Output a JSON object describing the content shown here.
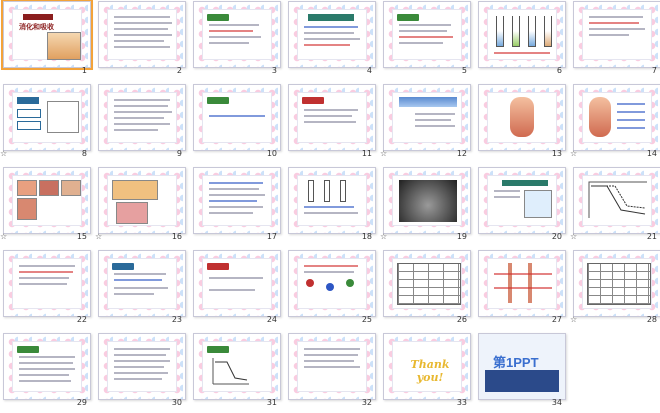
{
  "slides": [
    {
      "number": "1",
      "starred": false
    },
    {
      "number": "2",
      "starred": false
    },
    {
      "number": "3",
      "starred": false
    },
    {
      "number": "4",
      "starred": false
    },
    {
      "number": "5",
      "starred": false
    },
    {
      "number": "6",
      "starred": false
    },
    {
      "number": "7",
      "starred": false
    },
    {
      "number": "8",
      "starred": true
    },
    {
      "number": "9",
      "starred": false
    },
    {
      "number": "10",
      "starred": false
    },
    {
      "number": "11",
      "starred": false
    },
    {
      "number": "12",
      "starred": true
    },
    {
      "number": "13",
      "starred": false
    },
    {
      "number": "14",
      "starred": true
    },
    {
      "number": "15",
      "starred": true
    },
    {
      "number": "16",
      "starred": true
    },
    {
      "number": "17",
      "starred": false
    },
    {
      "number": "18",
      "starred": false
    },
    {
      "number": "19",
      "starred": true
    },
    {
      "number": "20",
      "starred": false
    },
    {
      "number": "21",
      "starred": true
    },
    {
      "number": "22",
      "starred": false
    },
    {
      "number": "23",
      "starred": false
    },
    {
      "number": "24",
      "starred": false
    },
    {
      "number": "25",
      "starred": false
    },
    {
      "number": "26",
      "starred": false
    },
    {
      "number": "27",
      "starred": false
    },
    {
      "number": "28",
      "starred": true
    },
    {
      "number": "29",
      "starred": false
    },
    {
      "number": "30",
      "starred": false
    },
    {
      "number": "31",
      "starred": false
    },
    {
      "number": "32",
      "starred": false
    },
    {
      "number": "33",
      "starred": false
    },
    {
      "number": "34",
      "starred": false
    }
  ],
  "star_glyph": "☆",
  "slide1_title": "消化和吸收",
  "slide33_text": "Thank you!",
  "slide34_text": "第1PPT",
  "colors": {
    "accent": "#f3a33a",
    "frame_pink": "#f7b7d4",
    "frame_blue": "#b7d5f7"
  }
}
